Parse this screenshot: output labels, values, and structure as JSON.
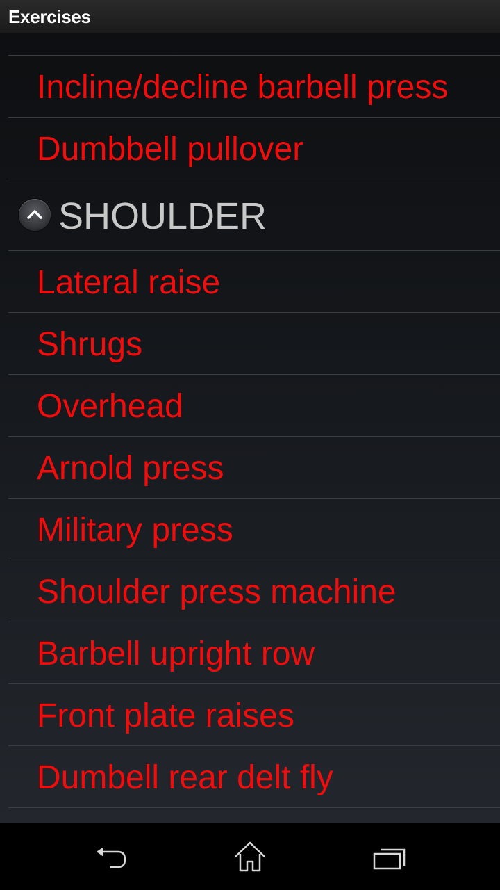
{
  "titlebar": {
    "title": "Exercises"
  },
  "list": {
    "items_before": [
      {
        "label": "Incline/decline barbell press"
      },
      {
        "label": "Dumbbell pullover"
      }
    ],
    "group": {
      "label": "SHOULDER",
      "icon": "chevron-up-icon",
      "expanded": true
    },
    "items": [
      {
        "label": "Lateral raise"
      },
      {
        "label": "Shrugs"
      },
      {
        "label": "Overhead"
      },
      {
        "label": "Arnold press"
      },
      {
        "label": "Military press"
      },
      {
        "label": "Shoulder press machine"
      },
      {
        "label": "Barbell upright row"
      },
      {
        "label": "Front plate raises"
      },
      {
        "label": "Dumbell rear delt fly"
      }
    ]
  },
  "navbar": {
    "back": {
      "icon": "back-icon"
    },
    "home": {
      "icon": "home-icon"
    },
    "recents": {
      "icon": "recents-icon"
    }
  },
  "colors": {
    "item_text": "#f00d0d",
    "group_text": "#c8c8c8",
    "divider": "#3a3d42",
    "title_text": "#ffffff"
  }
}
